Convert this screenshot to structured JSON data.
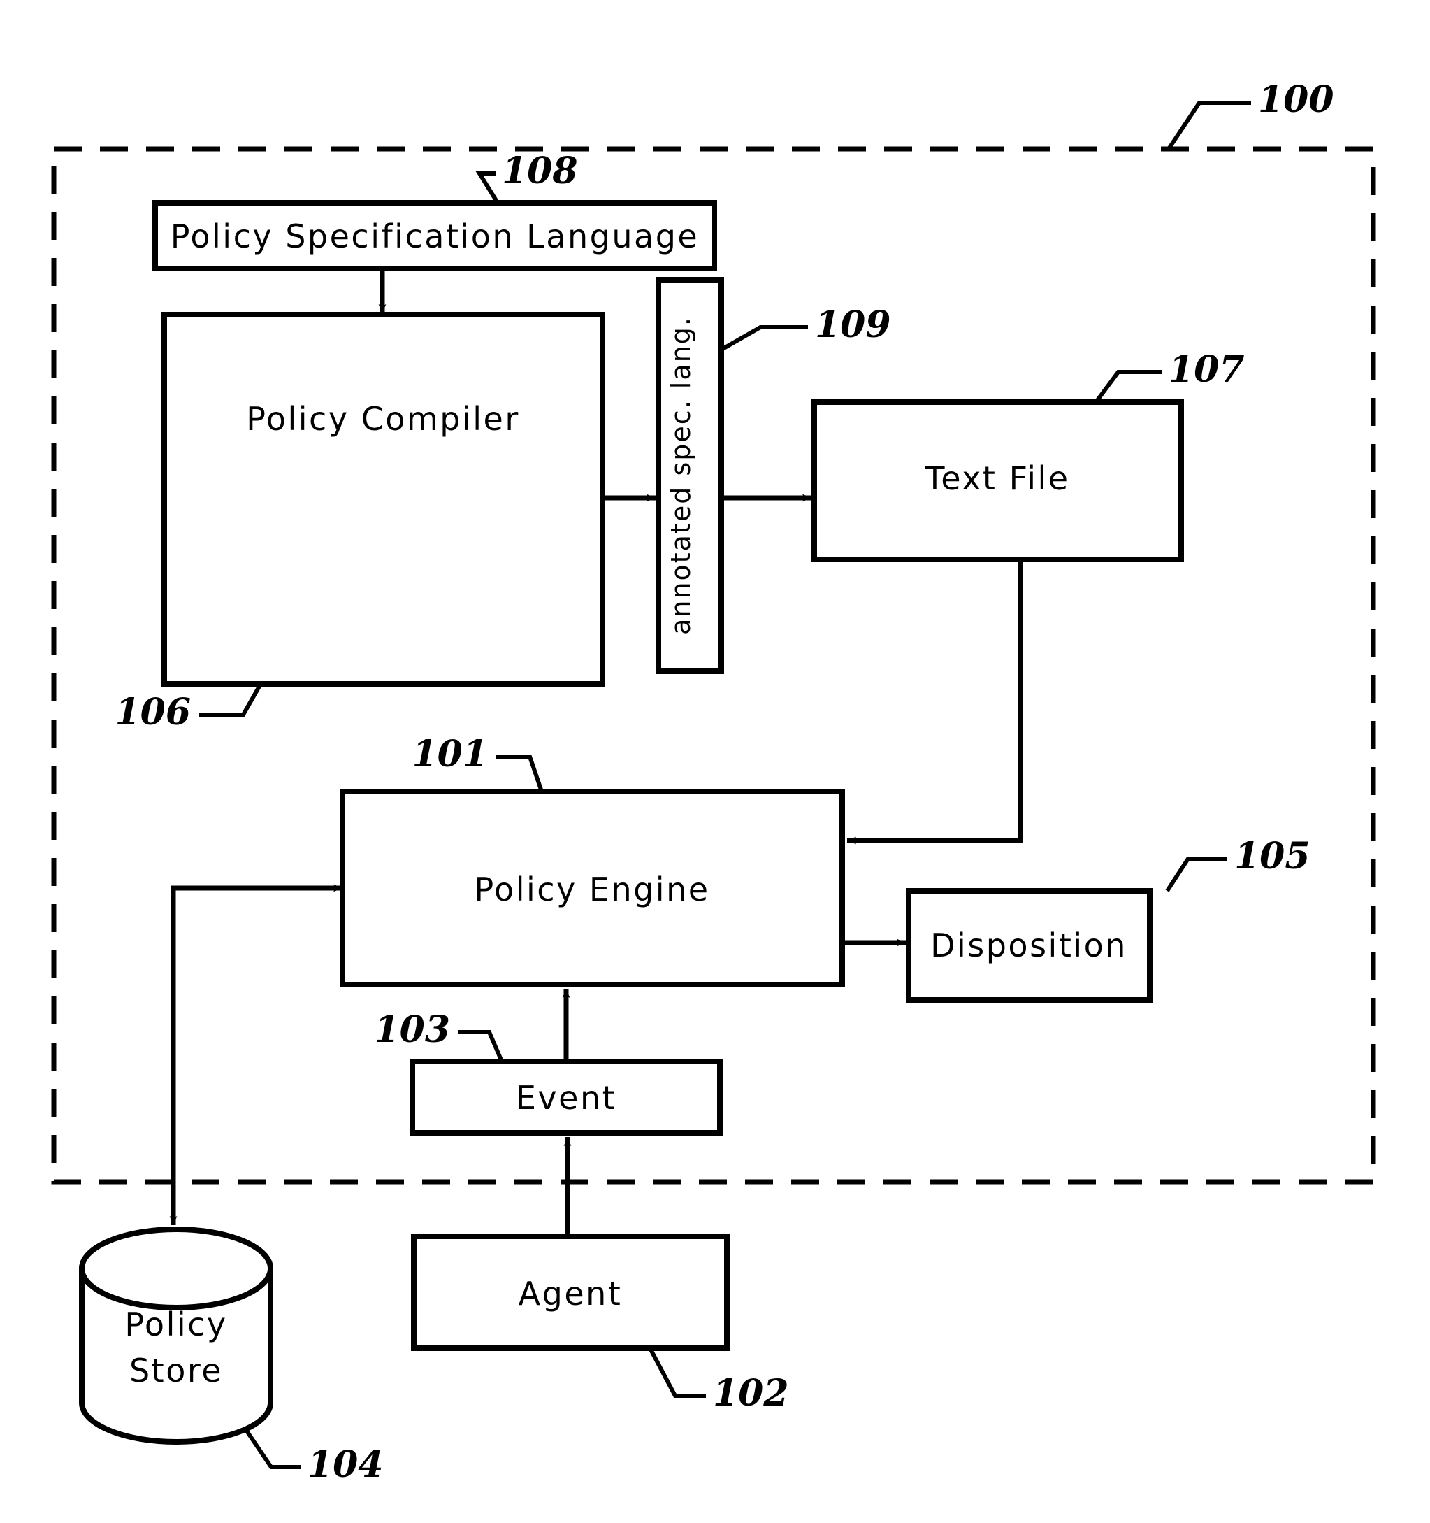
{
  "figure": {
    "type": "patent-block-diagram",
    "system_label": "100"
  },
  "boundary": {
    "name": "system-boundary",
    "style": "dashed",
    "ref": "100"
  },
  "blocks": [
    {
      "id": "policy-specification-language",
      "label": "Policy Specification Language",
      "ref": "108",
      "shape": "rect"
    },
    {
      "id": "policy-compiler",
      "label": "Policy Compiler",
      "ref": "106",
      "shape": "rect"
    },
    {
      "id": "annotated-spec-lang",
      "label": "annotated spec. lang.",
      "ref": "109",
      "shape": "rect-vertical"
    },
    {
      "id": "text-file",
      "label": "Text File",
      "ref": "107",
      "shape": "rect"
    },
    {
      "id": "policy-engine",
      "label": "Policy Engine",
      "ref": "101",
      "shape": "rect"
    },
    {
      "id": "disposition",
      "label": "Disposition",
      "ref": "105",
      "shape": "rect"
    },
    {
      "id": "event",
      "label": "Event",
      "ref": "103",
      "shape": "rect"
    },
    {
      "id": "agent",
      "label": "Agent",
      "ref": "102",
      "shape": "rect"
    },
    {
      "id": "policy-store",
      "label_line1": "Policy",
      "label_line2": "Store",
      "ref": "104",
      "shape": "cylinder"
    }
  ],
  "connections": [
    {
      "from": "policy-specification-language",
      "to": "policy-compiler",
      "arrow": true
    },
    {
      "from": "policy-compiler",
      "to": "annotated-spec-lang",
      "arrow": true
    },
    {
      "from": "annotated-spec-lang",
      "to": "text-file",
      "arrow": true
    },
    {
      "from": "text-file",
      "to": "policy-engine",
      "arrow": true
    },
    {
      "from": "policy-engine",
      "to": "disposition",
      "arrow": true
    },
    {
      "from": "event",
      "to": "policy-engine",
      "arrow": true
    },
    {
      "from": "agent",
      "to": "event",
      "arrow": true
    },
    {
      "from": "policy-engine",
      "to": "policy-store",
      "arrow": true
    },
    {
      "from": "policy-store",
      "to": "policy-engine",
      "arrow": true
    }
  ],
  "refs": {
    "r100": "100",
    "r101": "101",
    "r102": "102",
    "r103": "103",
    "r104": "104",
    "r105": "105",
    "r106": "106",
    "r107": "107",
    "r108": "108",
    "r109": "109"
  },
  "labels": {
    "psl": "Policy Specification Language",
    "compiler": "Policy Compiler",
    "annotated": "annotated spec. lang.",
    "textfile": "Text File",
    "engine": "Policy Engine",
    "disposition": "Disposition",
    "event": "Event",
    "agent": "Agent",
    "store_l1": "Policy",
    "store_l2": "Store"
  },
  "colors": {
    "ink": "#000000",
    "paper": "#ffffff"
  }
}
